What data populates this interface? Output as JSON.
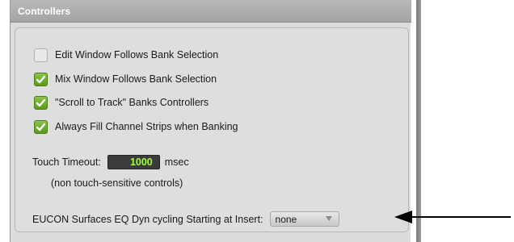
{
  "panel": {
    "title": "Controllers"
  },
  "checkboxes": [
    {
      "label": "Edit Window Follows Bank Selection",
      "checked": false
    },
    {
      "label": "Mix Window Follows Bank Selection",
      "checked": true
    },
    {
      "label": "\"Scroll to Track\" Banks Controllers",
      "checked": true
    },
    {
      "label": "Always Fill Channel Strips when Banking",
      "checked": true
    }
  ],
  "touch_timeout": {
    "label": "Touch Timeout:",
    "value": "1000",
    "unit": "msec",
    "note": "(non touch-sensitive controls)"
  },
  "eucon": {
    "label": "EUCON Surfaces EQ Dyn cycling Starting at Insert:",
    "selected": "none"
  },
  "colors": {
    "checkbox_on": "#6aab22",
    "timeout_text": "#9cff3a",
    "header": "#aeaeae"
  },
  "icons": {
    "check": "checkmark-icon",
    "caret": "chevron-down-icon",
    "callout": "arrow-left-icon"
  }
}
